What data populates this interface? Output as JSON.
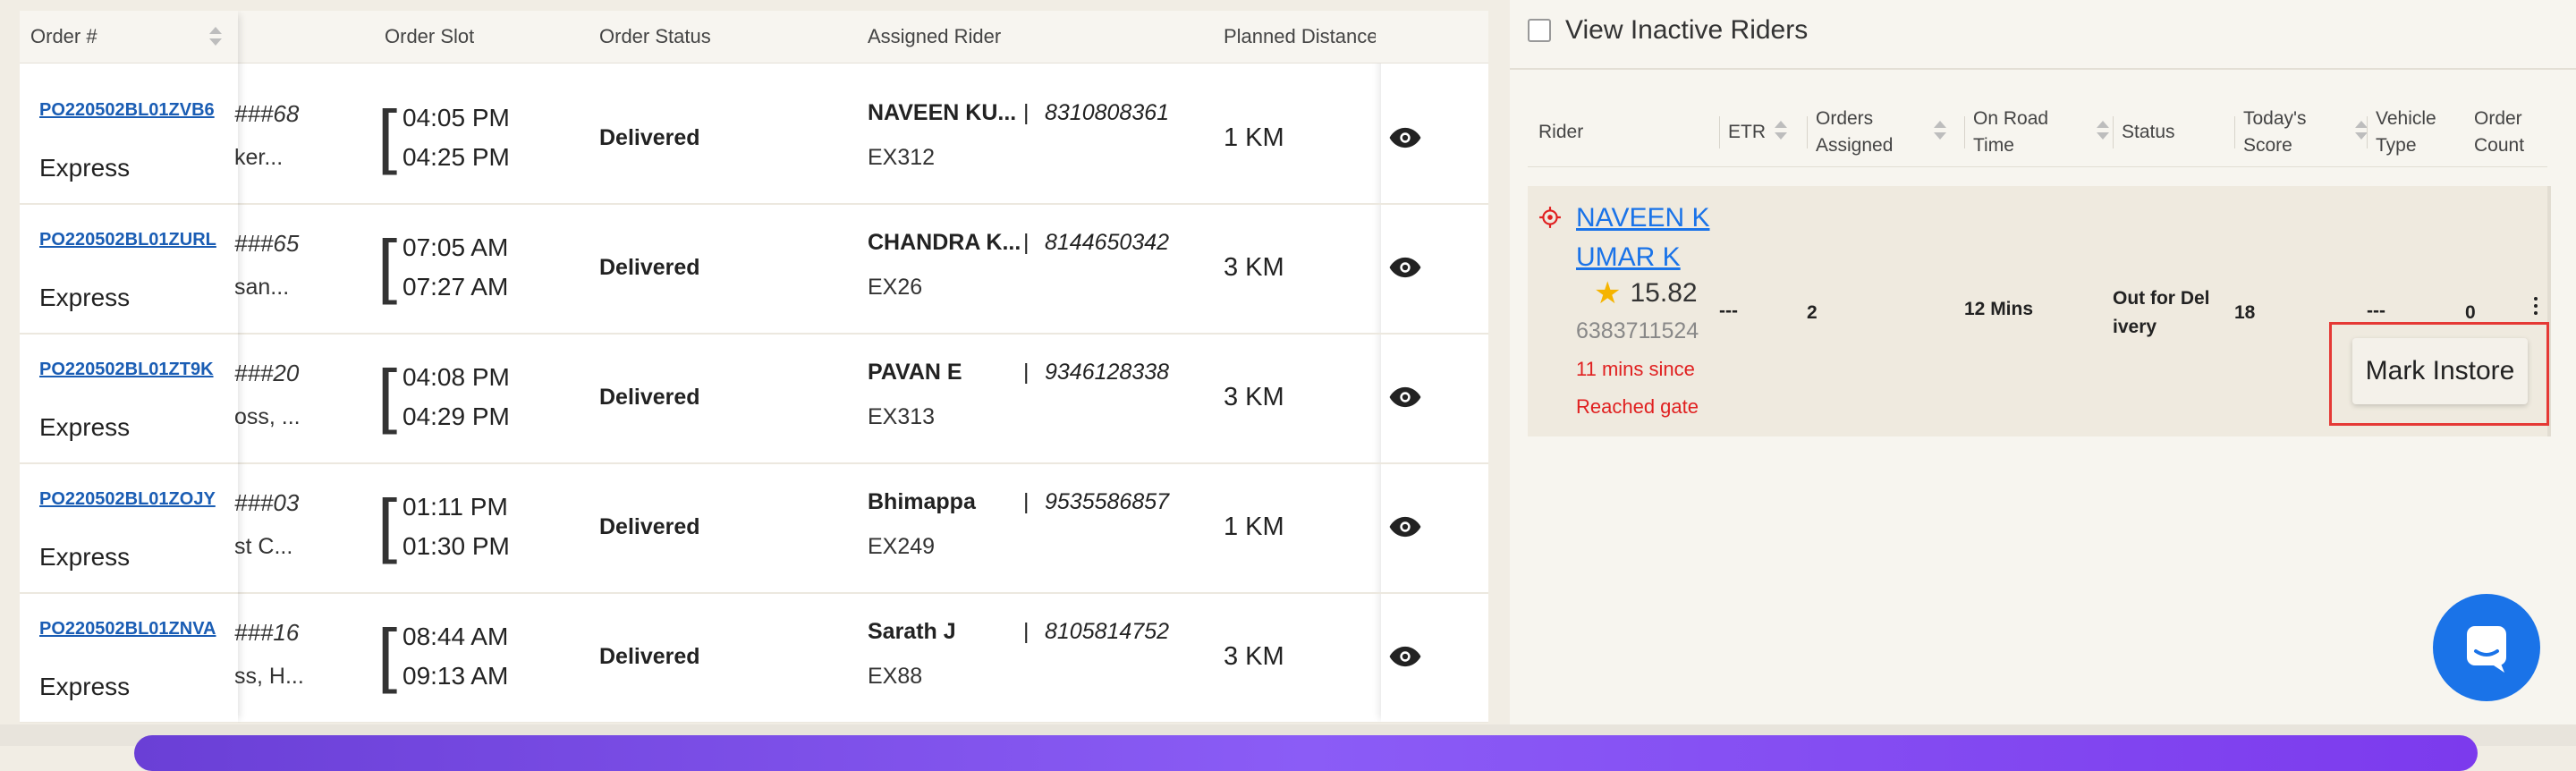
{
  "orders_table": {
    "columns": {
      "order_no": "Order #",
      "order_slot": "Order Slot",
      "order_status": "Order Status",
      "assigned_rider": "Assigned Rider",
      "planned_distance": "Planned Distance ("
    },
    "rows": [
      {
        "order_id": "PO220502BL01ZVB6",
        "type": "Express",
        "addr1": "###68",
        "addr2": "ker...",
        "slot_start": "04:05 PM",
        "slot_end": "04:25 PM",
        "status": "Delivered",
        "rider": "NAVEEN KU...",
        "pipe": "|",
        "phone": "8310808361",
        "rider_code": "EX312",
        "distance": "1 KM"
      },
      {
        "order_id": "PO220502BL01ZURL",
        "type": "Express",
        "addr1": "###65",
        "addr2": "san...",
        "slot_start": "07:05 AM",
        "slot_end": "07:27 AM",
        "status": "Delivered",
        "rider": "CHANDRA K...",
        "pipe": "|",
        "phone": "8144650342",
        "rider_code": "EX26",
        "distance": "3 KM"
      },
      {
        "order_id": "PO220502BL01ZT9K",
        "type": "Express",
        "addr1": "###20",
        "addr2": "oss, ...",
        "slot_start": "04:08 PM",
        "slot_end": "04:29 PM",
        "status": "Delivered",
        "rider": "PAVAN E",
        "pipe": "|",
        "phone": "9346128338",
        "rider_code": "EX313",
        "distance": "3 KM"
      },
      {
        "order_id": "PO220502BL01ZOJY",
        "type": "Express",
        "addr1": "###03",
        "addr2": "st C...",
        "slot_start": "01:11 PM",
        "slot_end": "01:30 PM",
        "status": "Delivered",
        "rider": "Bhimappa",
        "pipe": "|",
        "phone": "9535586857",
        "rider_code": "EX249",
        "distance": "1 KM"
      },
      {
        "order_id": "PO220502BL01ZNVA",
        "type": "Express",
        "addr1": "###16",
        "addr2": "ss, H...",
        "slot_start": "08:44 AM",
        "slot_end": "09:13 AM",
        "status": "Delivered",
        "rider": "Sarath J",
        "pipe": "|",
        "phone": "8105814752",
        "rider_code": "EX88",
        "distance": "3 KM"
      }
    ]
  },
  "rider_panel": {
    "view_inactive_label": "View Inactive Riders",
    "columns": {
      "rider": "Rider",
      "etr": "ETR",
      "orders_assigned_1": "Orders",
      "orders_assigned_2": "Assigned",
      "on_road_1": "On Road",
      "on_road_2": "Time",
      "status": "Status",
      "score_1": "Today's",
      "score_2": "Score",
      "vehicle_1": "Vehicle",
      "vehicle_2": "Type",
      "order_count_1": "Order",
      "order_count_2": "Count"
    },
    "rider": {
      "name_line1": "NAVEEN K",
      "name_line2": "UMAR K",
      "score": "15.82",
      "phone": "6383711524",
      "since": "11 mins since",
      "gate": "Reached gate",
      "etr": "---",
      "orders_assigned": "2",
      "on_road_time": "12 Mins",
      "status_1": "Out for Del",
      "status_2": "ivery",
      "todays_score": "18",
      "vehicle_type": "---",
      "order_count": "0"
    },
    "menu": {
      "mark_instore": "Mark Instore"
    }
  },
  "colors": {
    "link": "#1a5db4",
    "alert": "#e02020",
    "chat": "#1a73e8",
    "highlight": "#e53935"
  },
  "icons": [
    "sort-icon",
    "eye-icon",
    "checkbox-icon",
    "location-icon",
    "star-icon",
    "kebab-icon",
    "chat-icon"
  ]
}
